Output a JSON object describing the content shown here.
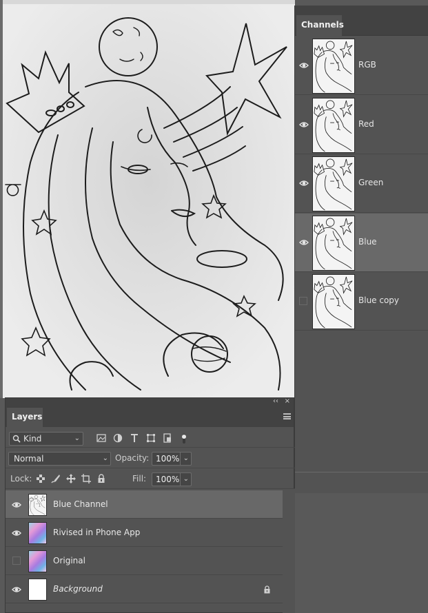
{
  "channels_panel": {
    "tab_label": "Channels",
    "channels": [
      {
        "name": "RGB",
        "visible": true,
        "selected": false
      },
      {
        "name": "Red",
        "visible": true,
        "selected": false
      },
      {
        "name": "Green",
        "visible": true,
        "selected": false
      },
      {
        "name": "Blue",
        "visible": true,
        "selected": true
      },
      {
        "name": "Blue copy",
        "visible": false,
        "selected": false
      }
    ]
  },
  "layers_panel": {
    "tab_label": "Layers",
    "collapse_glyph": "‹‹",
    "close_glyph": "×",
    "filter_kind": "Kind",
    "blend_mode": "Normal",
    "opacity_label": "Opacity:",
    "opacity_value": "100%",
    "lock_label": "Lock:",
    "fill_label": "Fill:",
    "fill_value": "100%",
    "layers": [
      {
        "name": "Blue Channel",
        "visible": true,
        "selected": true,
        "thumb": "line-art"
      },
      {
        "name": "Rivised in Phone App",
        "visible": true,
        "selected": false,
        "thumb": "color"
      },
      {
        "name": "Original",
        "visible": false,
        "selected": false,
        "thumb": "color"
      },
      {
        "name": "Background",
        "visible": true,
        "selected": false,
        "thumb": "white",
        "locked": true
      }
    ]
  },
  "colors": {
    "panel_bg": "#535353",
    "selected_row": "#696969",
    "tab_bar": "#424242"
  }
}
